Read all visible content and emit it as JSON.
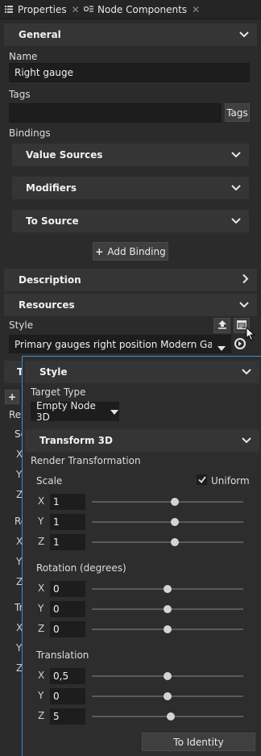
{
  "tabs": [
    {
      "label": "Properties"
    },
    {
      "label": "Node Components"
    }
  ],
  "general": {
    "title": "General",
    "name_label": "Name",
    "name_value": "Right gauge",
    "tags_label": "Tags",
    "tags_value": "",
    "tags_button": "Tags",
    "bindings_label": "Bindings",
    "value_sources": "Value Sources",
    "modifiers": "Modifiers",
    "to_source": "To Source",
    "add_binding": "Add Binding"
  },
  "description": {
    "title": "Description"
  },
  "resources": {
    "title": "Resources",
    "style_label": "Style",
    "style_value": "Primary gauges right position Modern Gasolir"
  },
  "background_partial": {
    "t_letter": "T",
    "rend_label": "Ren",
    "rows": [
      "Sc",
      "X",
      "Y",
      "Z",
      "Re",
      "X",
      "Y",
      "Z",
      "Tr",
      "X",
      "Y",
      "Z"
    ]
  },
  "popup": {
    "style_title": "Style",
    "target_type_label": "Target Type",
    "target_type_value": "Empty Node 3D",
    "transform_title": "Transform 3D",
    "render_transformation_label": "Render Transformation",
    "scale": {
      "label": "Scale",
      "uniform_label": "Uniform",
      "uniform_checked": true,
      "x": "1",
      "y": "1",
      "z": "1",
      "x_level": 0.55,
      "y_level": 0.55,
      "z_level": 0.55
    },
    "rotation": {
      "label": "Rotation (degrees)",
      "x": "0",
      "y": "0",
      "z": "0",
      "x_level": 0.5,
      "y_level": 0.5,
      "z_level": 0.5
    },
    "translation": {
      "label": "Translation",
      "x": "0,5",
      "y": "0",
      "z": "5",
      "x_level": 0.5,
      "y_level": 0.5,
      "z_level": 0.52
    },
    "axis_x": "X",
    "axis_y": "Y",
    "axis_z": "Z",
    "to_identity": "To Identity"
  },
  "colors": {
    "accent": "#3a8fd6",
    "panel": "#2b2b2b",
    "header": "#353535"
  }
}
